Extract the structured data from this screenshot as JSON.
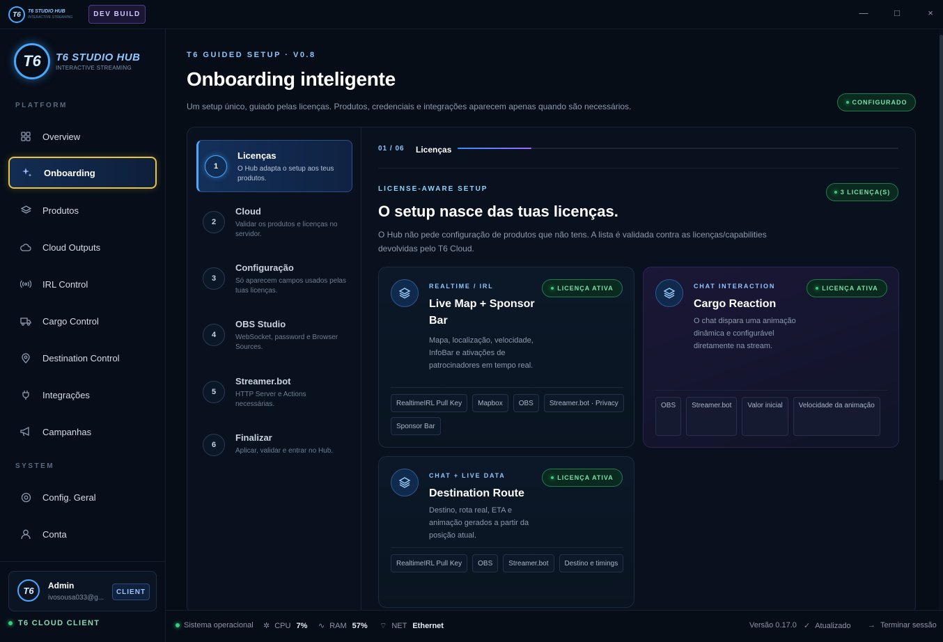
{
  "titlebar": {
    "logo_text": "T6",
    "brand": "T6 STUDIO HUB",
    "brand_sub": "INTERACTIVE STREAMING",
    "dev_badge": "DEV BUILD",
    "minimize": "—",
    "maximize": "□",
    "close": "×"
  },
  "sidebar": {
    "logo_text": "T6",
    "brand": "T6 STUDIO HUB",
    "brand_sub": "INTERACTIVE STREAMING",
    "section_platform": "PLATFORM",
    "section_system": "SYSTEM",
    "items": [
      {
        "label": "Overview",
        "icon": "grid-icon"
      },
      {
        "label": "Onboarding",
        "icon": "sparkles-icon"
      },
      {
        "label": "Produtos",
        "icon": "layers-icon"
      },
      {
        "label": "Cloud Outputs",
        "icon": "cloud-icon"
      },
      {
        "label": "IRL Control",
        "icon": "broadcast-icon"
      },
      {
        "label": "Cargo Control",
        "icon": "truck-icon"
      },
      {
        "label": "Destination Control",
        "icon": "map-pin-icon"
      },
      {
        "label": "Integrações",
        "icon": "plug-icon"
      },
      {
        "label": "Campanhas",
        "icon": "megaphone-icon"
      },
      {
        "label": "Config. Geral",
        "icon": "gear-icon"
      },
      {
        "label": "Conta",
        "icon": "user-icon"
      }
    ],
    "user": {
      "avatar_text": "T6",
      "name": "Admin",
      "email": "ivosousa033@g...",
      "badge": "CLIENT"
    },
    "cloud_client": "T6 CLOUD CLIENT"
  },
  "main": {
    "eyebrow": "T6 GUIDED SETUP · V0.8",
    "title": "Onboarding inteligente",
    "subtitle": "Um setup único, guiado pelas licenças. Produtos, credenciais e integrações aparecem apenas quando são necessários.",
    "status": "CONFIGURADO",
    "steps": [
      {
        "num": "1",
        "title": "Licenças",
        "desc": "O Hub adapta o setup aos teus produtos."
      },
      {
        "num": "2",
        "title": "Cloud",
        "desc": "Validar os produtos e licenças no servidor."
      },
      {
        "num": "3",
        "title": "Configuração",
        "desc": "Só aparecem campos usados pelas tuas licenças."
      },
      {
        "num": "4",
        "title": "OBS Studio",
        "desc": "WebSocket, password e Browser Sources."
      },
      {
        "num": "5",
        "title": "Streamer.bot",
        "desc": "HTTP Server e Actions necessárias."
      },
      {
        "num": "6",
        "title": "Finalizar",
        "desc": "Aplicar, validar e entrar no Hub."
      }
    ],
    "progress": {
      "count": "01 / 06",
      "label": "Licenças",
      "fraction": 0.167
    },
    "content": {
      "eyebrow": "LICENSE-AWARE SETUP",
      "title": "O setup nasce das tuas licenças.",
      "desc": "O Hub não pede configuração de produtos que não tens. A lista é validada contra as licenças/capabilities devolvidas pelo T6 Cloud.",
      "license_count": "3 LICENÇA(S)"
    },
    "cards": [
      {
        "eyebrow": "REALTIME / IRL",
        "title": "Live Map + Sponsor Bar",
        "desc": "Mapa, localização, velocidade, InfoBar e ativações de patrocinadores em tempo real.",
        "badge": "LICENÇA ATIVA",
        "tags": [
          "RealtimeIRL Pull Key",
          "Mapbox",
          "OBS",
          "Streamer.bot · Privacy",
          "Sponsor Bar"
        ]
      },
      {
        "eyebrow": "CHAT INTERACTION",
        "title": "Cargo Reaction",
        "desc": "O chat dispara uma animação dinâmica e configurável diretamente na stream.",
        "badge": "LICENÇA ATIVA",
        "tags": [
          "OBS",
          "Streamer.bot",
          "Valor inicial",
          "Velocidade da animação"
        ]
      },
      {
        "eyebrow": "CHAT + LIVE DATA",
        "title": "Destination Route",
        "desc": "Destino, rota real, ETA e animação gerados a partir da posição atual.",
        "badge": "LICENÇA ATIVA",
        "tags": [
          "RealtimeIRL Pull Key",
          "OBS",
          "Streamer.bot",
          "Destino e timings"
        ]
      }
    ]
  },
  "statusbar": {
    "system": "Sistema operacional",
    "cpu_label": "CPU",
    "cpu_value": "7%",
    "ram_label": "RAM",
    "ram_value": "57%",
    "net_label": "NET",
    "net_value": "Ethernet",
    "version": "Versão 0.17.0",
    "updated": "Atualizado",
    "logout": "Terminar sessão"
  },
  "colors": {
    "accent": "#4aa8ff",
    "active_outline": "#e8c34a",
    "success": "#2fd07a",
    "background": "#050b14"
  }
}
